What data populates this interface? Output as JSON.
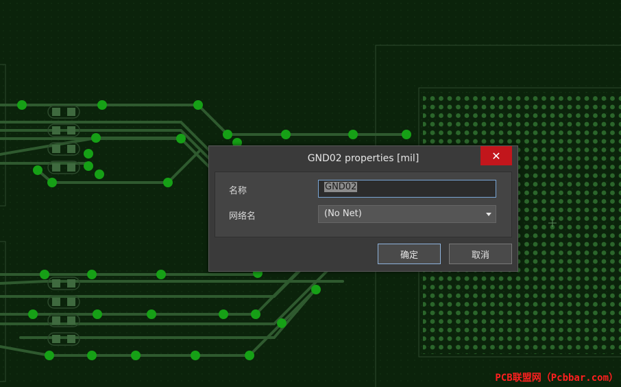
{
  "dialog": {
    "title": "GND02 properties [mil]",
    "close_label": "✕",
    "fields": {
      "name_label": "名称",
      "name_value": "GND02",
      "net_label": "网络名",
      "net_value": "(No Net)"
    },
    "buttons": {
      "ok": "确定",
      "cancel": "取消"
    }
  },
  "watermark": "PCB联盟网（Pcbbar.com）",
  "colors": {
    "board_background": "#0b230b",
    "trace": "#2f5a2f",
    "via": "#16a016",
    "pad_grid": "#2b662b",
    "close_button": "#c2161c",
    "focus_border": "#79a6d6"
  }
}
